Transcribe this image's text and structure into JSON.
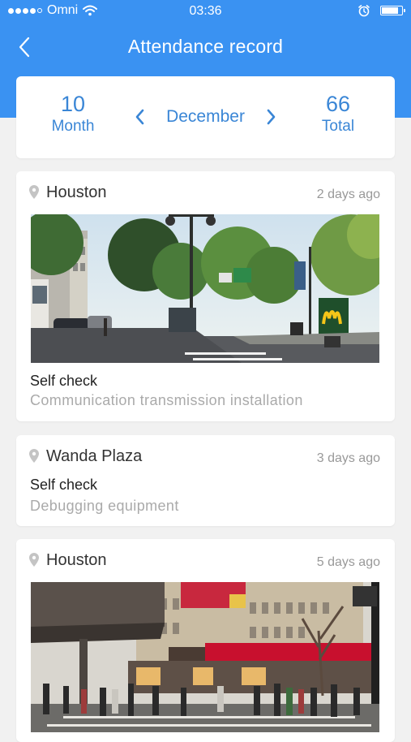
{
  "status_bar": {
    "carrier": "Omni",
    "time": "03:36",
    "signal_icon": "signal-dots-icon",
    "wifi_icon": "wifi-icon",
    "alarm_icon": "alarm-icon",
    "battery_icon": "battery-icon",
    "battery_level": 0.85
  },
  "nav": {
    "title": "Attendance record",
    "back_icon": "chevron-left-icon"
  },
  "summary": {
    "month_number": "10",
    "month_label": "Month",
    "current_month": "December",
    "total_number": "66",
    "total_label": "Total",
    "prev_icon": "chevron-left-icon",
    "next_icon": "chevron-right-icon"
  },
  "records": [
    {
      "location": "Houston",
      "time_ago": "2 days ago",
      "has_photo": true,
      "photo_desc": "Street scene with trees, lamp posts and a McDonald's sign",
      "check_type": "Self check",
      "description": "Communication transmission installation"
    },
    {
      "location": "Wanda Plaza",
      "time_ago": "3 days ago",
      "has_photo": false,
      "check_type": "Self check",
      "description": "Debugging equipment"
    },
    {
      "location": "Houston",
      "time_ago": "5 days ago",
      "has_photo": true,
      "photo_desc": "Busy crosswalk in front of Galeries Lafayette department store"
    }
  ],
  "colors": {
    "primary": "#3a92f2",
    "accent_text": "#3a86d6",
    "background": "#f1f1f1",
    "muted": "#aaaaaa"
  }
}
